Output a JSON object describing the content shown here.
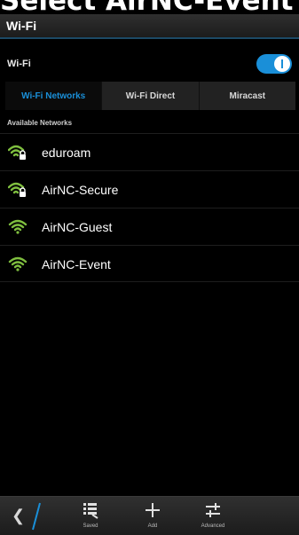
{
  "page_heading": "Select AirNC-Event",
  "header": {
    "title": "Wi-Fi"
  },
  "wifi_toggle": {
    "label": "Wi-Fi",
    "state": "on"
  },
  "tabs": [
    {
      "label": "Wi-Fi Networks",
      "selected": true
    },
    {
      "label": "Wi-Fi Direct",
      "selected": false
    },
    {
      "label": "Miracast",
      "selected": false
    }
  ],
  "section_label": "Available Networks",
  "networks": [
    {
      "name": "eduroam",
      "secured": true,
      "icon": "wifi-secured-icon"
    },
    {
      "name": "AirNC-Secure",
      "secured": true,
      "icon": "wifi-secured-icon"
    },
    {
      "name": "AirNC-Guest",
      "secured": false,
      "icon": "wifi-icon"
    },
    {
      "name": "AirNC-Event",
      "secured": false,
      "icon": "wifi-icon"
    }
  ],
  "actions": {
    "back": {
      "icon": "chevron-left-icon"
    },
    "saved": {
      "label": "Saved",
      "icon": "saved-list-icon"
    },
    "add": {
      "label": "Add",
      "icon": "plus-icon"
    },
    "advanced": {
      "label": "Advanced",
      "icon": "sliders-icon"
    }
  },
  "colors": {
    "accent": "#1a8fd8",
    "signal": "#7fbf3f",
    "background": "#000000"
  }
}
